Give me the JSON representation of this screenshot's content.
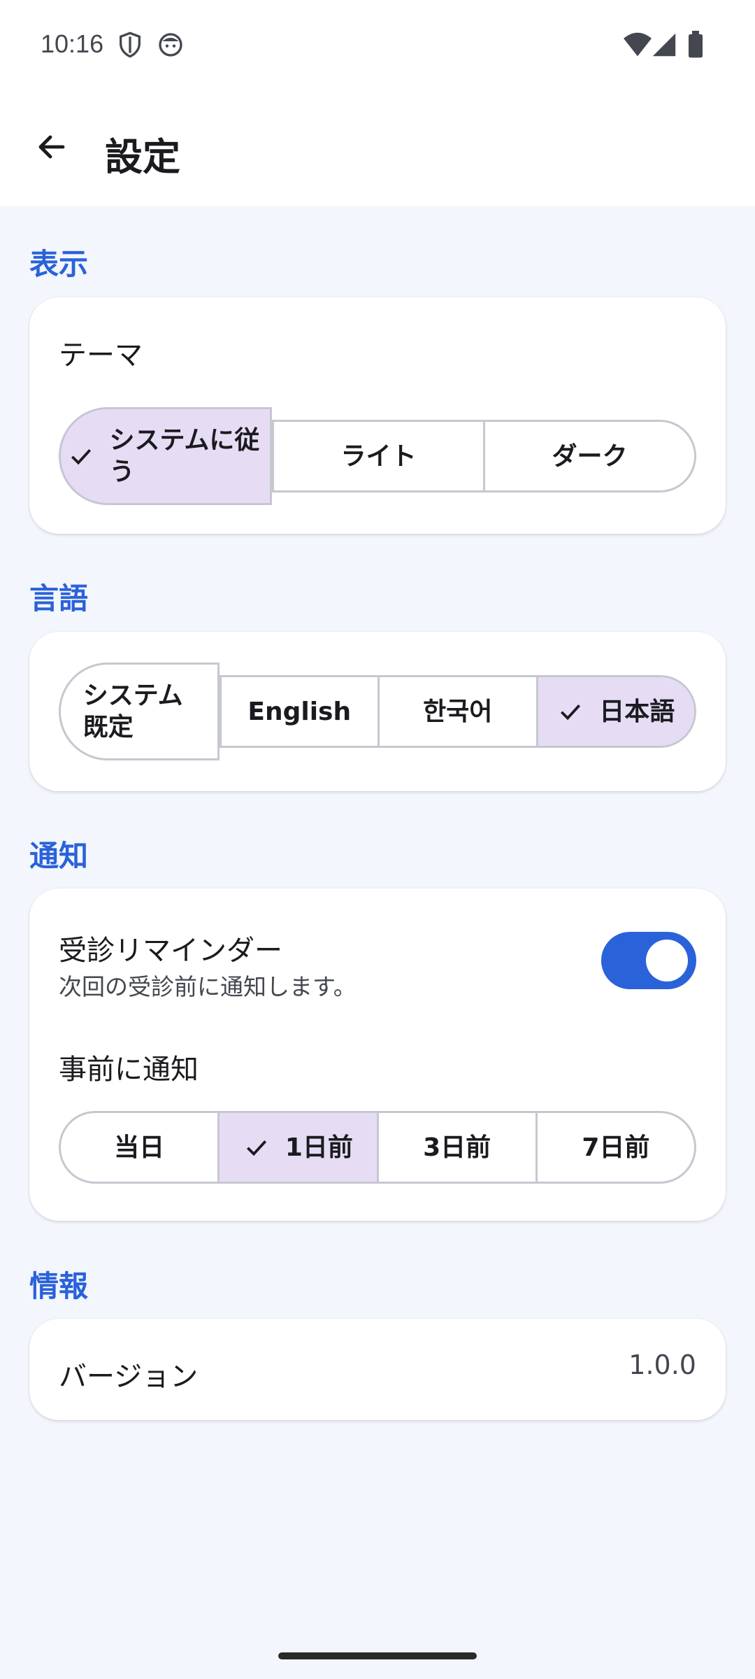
{
  "status": {
    "time": "10:16"
  },
  "appbar": {
    "title": "設定"
  },
  "display": {
    "section_title": "表示",
    "theme_label": "テーマ",
    "options": [
      "システムに従う",
      "ライト",
      "ダーク"
    ],
    "selected": "システムに従う"
  },
  "language": {
    "section_title": "言語",
    "options": [
      "システム既定",
      "English",
      "한국어",
      "日本語"
    ],
    "selected": "日本語"
  },
  "notify": {
    "section_title": "通知",
    "reminder_label": "受診リマインダー",
    "reminder_desc": "次回の受診前に通知します。",
    "reminder_enabled": true,
    "advance_label": "事前に通知",
    "options": [
      "当日",
      "1日前",
      "3日前",
      "7日前"
    ],
    "selected": "1日前"
  },
  "info": {
    "section_title": "情報",
    "version_label": "バージョン",
    "version_value": "1.0.0"
  },
  "colors": {
    "accent": "#2a62d9",
    "selected_bg": "#e6ddf5",
    "background": "#f3f6fd"
  }
}
